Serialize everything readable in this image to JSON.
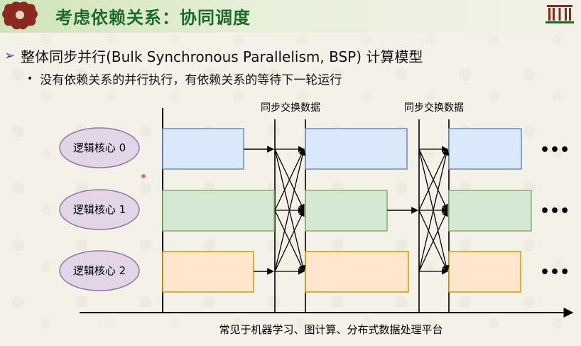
{
  "slide": {
    "title": "考虑依赖关系：协同调度",
    "bullet_main": "整体同步并行(Bulk Synchronous Parallelism, BSP) 计算模型",
    "bullet_sub": "没有依赖关系的并行执行，有依赖关系的等待下一轮运行"
  },
  "diagram": {
    "sync_labels": [
      "同步交换数据",
      "同步交换数据"
    ],
    "cores": [
      "逻辑核心 0",
      "逻辑核心 1",
      "逻辑核心 2"
    ],
    "ellipsis": "•••",
    "caption": "常见于机器学习、图计算、分布式数据处理平台"
  },
  "colors": {
    "title_green": "#1d6a2a",
    "blue_fill": "#dae8fc",
    "blue_stroke": "#6c8ebf",
    "green_fill": "#d5e8d4",
    "green_stroke": "#82b366",
    "orange_fill": "#ffe6cc",
    "orange_stroke": "#d79b00",
    "ellipse_fill": "#e1d5e7",
    "ellipse_stroke": "#9673a6"
  }
}
